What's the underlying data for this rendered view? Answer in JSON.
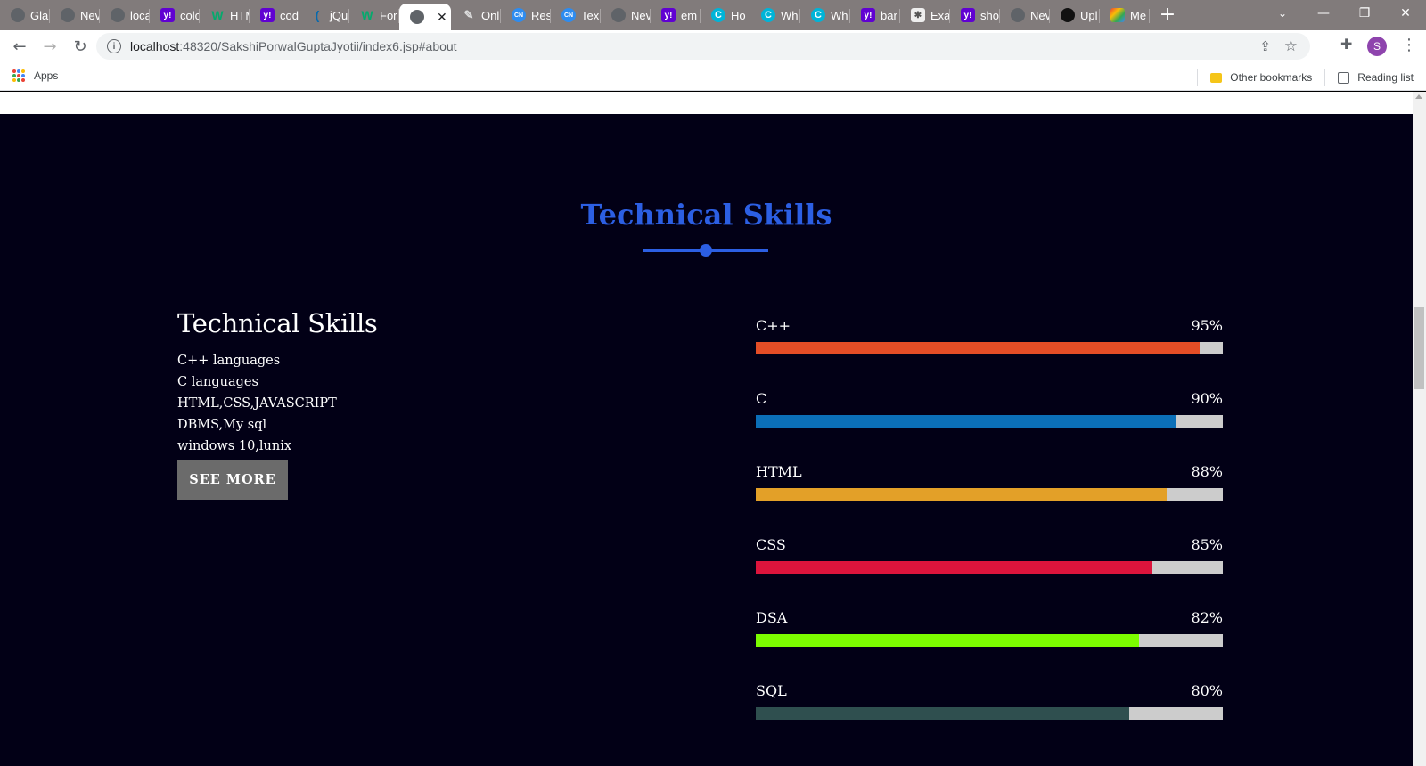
{
  "browser": {
    "tabs": [
      {
        "title": "Gla",
        "icon": "globe-icon",
        "kind": "globe"
      },
      {
        "title": "Nev",
        "icon": "globe-icon",
        "kind": "globe"
      },
      {
        "title": "loca",
        "icon": "globe-icon",
        "kind": "globe"
      },
      {
        "title": "colo",
        "icon": "yahoo-icon",
        "kind": "yahoo",
        "glyph": "y!"
      },
      {
        "title": "HTM",
        "icon": "w3schools-icon",
        "kind": "w3",
        "glyph": "W"
      },
      {
        "title": "cod",
        "icon": "yahoo-icon",
        "kind": "yahoo",
        "glyph": "y!"
      },
      {
        "title": "jQu",
        "icon": "jquery-icon",
        "kind": "jq",
        "glyph": "("
      },
      {
        "title": "For",
        "icon": "w3schools-icon",
        "kind": "w3",
        "glyph": "W"
      },
      {
        "title": "",
        "icon": "globe-icon",
        "kind": "globe",
        "active": true
      },
      {
        "title": "Onl",
        "icon": "pen-icon",
        "kind": "pen",
        "glyph": "✎"
      },
      {
        "title": "Res",
        "icon": "codingninjas-icon",
        "kind": "cn",
        "glyph": "CN"
      },
      {
        "title": "Tex",
        "icon": "codingninjas-icon",
        "kind": "cn",
        "glyph": "CN"
      },
      {
        "title": "Nev",
        "icon": "globe-icon",
        "kind": "globe"
      },
      {
        "title": "em",
        "icon": "yahoo-icon",
        "kind": "yahoo",
        "glyph": "y!"
      },
      {
        "title": "Ho",
        "icon": "c-icon",
        "kind": "c",
        "glyph": "C"
      },
      {
        "title": "Wh",
        "icon": "c-icon",
        "kind": "c",
        "glyph": "C"
      },
      {
        "title": "Wh",
        "icon": "c-icon",
        "kind": "c",
        "glyph": "C"
      },
      {
        "title": "bar",
        "icon": "yahoo-icon",
        "kind": "yahoo",
        "glyph": "y!"
      },
      {
        "title": "Exa",
        "icon": "example-icon",
        "kind": "ex",
        "glyph": "✱"
      },
      {
        "title": "sho",
        "icon": "yahoo-icon",
        "kind": "yahoo",
        "glyph": "y!"
      },
      {
        "title": "Nev",
        "icon": "globe-icon",
        "kind": "globe"
      },
      {
        "title": "Upl",
        "icon": "github-icon",
        "kind": "gh"
      },
      {
        "title": "Me",
        "icon": "meet-icon",
        "kind": "me"
      }
    ],
    "new_tab_glyph": "+",
    "url_host": "localhost",
    "url_path": ":48320/SakshiPorwalGuptaJyotii/index6.jsp#about",
    "profile_initial": "S",
    "bookmarks": {
      "apps_label": "Apps",
      "other_label": "Other bookmarks",
      "reading_label": "Reading list"
    }
  },
  "page": {
    "section_title": "Technical Skills",
    "left": {
      "heading": "Technical Skills",
      "items": [
        "C++ languages",
        "C languages",
        "HTML,CSS,JAVASCRIPT",
        "DBMS,My sql",
        "windows 10,lunix"
      ],
      "button_label": "SEE MORE"
    },
    "skills": [
      {
        "name": "C++",
        "percent_label": "95%",
        "value": 0.95,
        "color": "#e44d26"
      },
      {
        "name": "C",
        "percent_label": "90%",
        "value": 0.9,
        "color": "#0b6fb8"
      },
      {
        "name": "HTML",
        "percent_label": "88%",
        "value": 0.88,
        "color": "#e3a028"
      },
      {
        "name": "CSS",
        "percent_label": "85%",
        "value": 0.85,
        "color": "#dc143c"
      },
      {
        "name": "DSA",
        "percent_label": "82%",
        "value": 0.82,
        "color": "#7cfc00"
      },
      {
        "name": "SQL",
        "percent_label": "80%",
        "value": 0.8,
        "color": "#2f4f4f"
      }
    ]
  },
  "colors": {
    "accent": "#2c5fe3",
    "section_bg": "#020016",
    "track": "#cccccc"
  }
}
